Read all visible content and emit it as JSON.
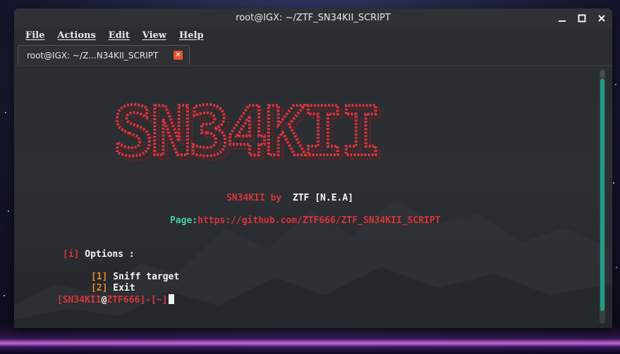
{
  "window": {
    "title": "root@IGX: ~/ZTF_SN34KII_SCRIPT",
    "controls": [
      "minimize-icon",
      "maximize-icon",
      "close-icon"
    ]
  },
  "menu": {
    "file": "File",
    "actions": "Actions",
    "edit": "Edit",
    "view": "View",
    "help": "Help"
  },
  "tab": {
    "label": "root@IGX: ~/Z...N34KII_SCRIPT",
    "close_icon": "close-icon"
  },
  "terminal": {
    "banner_text": "SN34KII",
    "byline_name": "SN34KII by",
    "byline_author": "ZTF [N.E.A]",
    "page_label": "Page:",
    "page_url": "https://github.com/ZTF666/ZTF_SN34KII_SCRIPT",
    "options_bracket": "[i]",
    "options_label": "Options :",
    "options": [
      {
        "key": "[1]",
        "label": "Sniff target"
      },
      {
        "key": "[2]",
        "label": "Exit"
      }
    ],
    "prompt": {
      "open": "[SN34KII",
      "at": "@",
      "host": "ZTF666]",
      "dash": "-",
      "dir": "[~]"
    }
  },
  "colors": {
    "accent_red": "#d8343a",
    "teal": "#49c9a8",
    "orange": "#e8842c",
    "scrollbar": "#1f9e84"
  }
}
